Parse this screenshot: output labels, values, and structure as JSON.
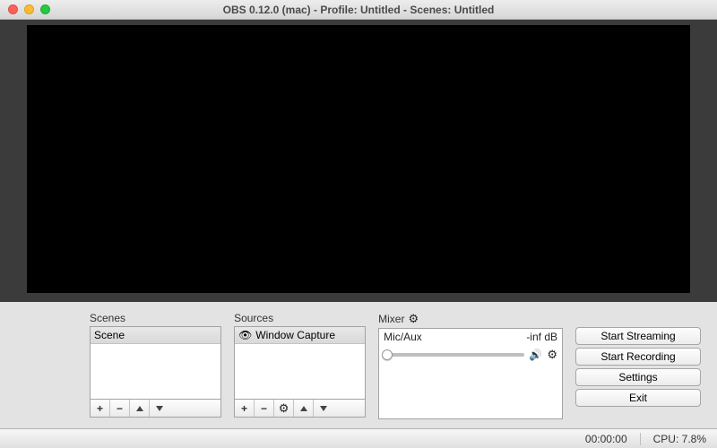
{
  "window": {
    "title": "OBS 0.12.0 (mac) - Profile: Untitled - Scenes: Untitled"
  },
  "panels": {
    "scenes_label": "Scenes",
    "sources_label": "Sources",
    "mixer_label": "Mixer"
  },
  "scenes": {
    "items": [
      {
        "name": "Scene"
      }
    ]
  },
  "sources": {
    "items": [
      {
        "name": "Window Capture"
      }
    ]
  },
  "mixer": {
    "channel": "Mic/Aux",
    "level": "-inf dB"
  },
  "buttons": {
    "start_streaming": "Start Streaming",
    "start_recording": "Start Recording",
    "settings": "Settings",
    "exit": "Exit"
  },
  "status": {
    "time": "00:00:00",
    "cpu": "CPU: 7.8%"
  }
}
